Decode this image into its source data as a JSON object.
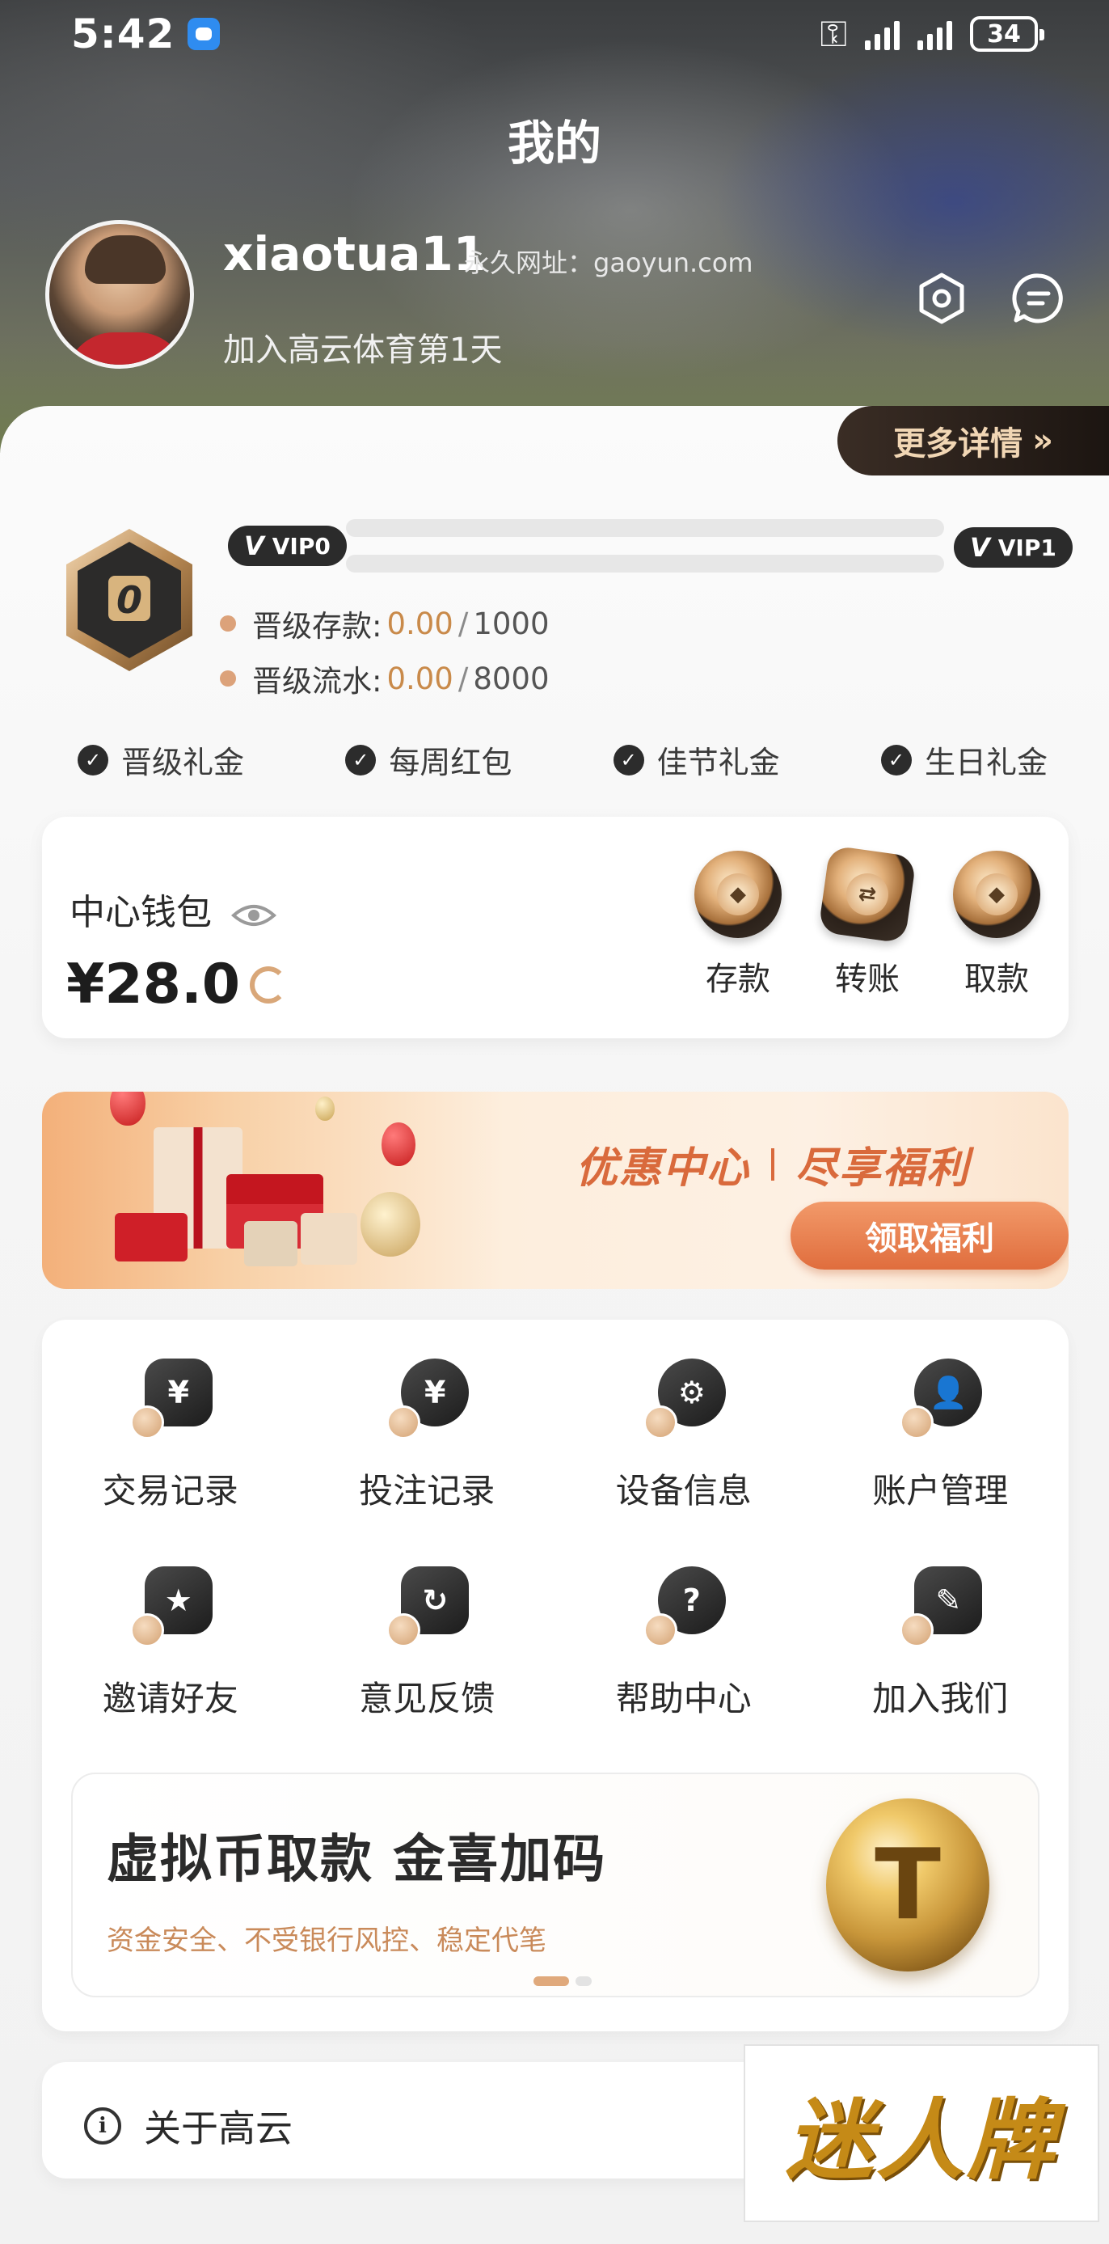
{
  "status_bar": {
    "time": "5:42",
    "battery": "34"
  },
  "header": {
    "title": "我的",
    "username": "xiaotua11",
    "perma_url": "永久网址：gaoyun.com",
    "join_days": "加入高云体育第1天"
  },
  "more_details": {
    "label": "更多详情",
    "arrow": "»"
  },
  "vip": {
    "badge_text": "0",
    "current_level": "VIP0",
    "next_level": "VIP1",
    "deposit_label": "晋级存款:",
    "deposit_current": "0.00",
    "deposit_target": "1000",
    "turnover_label": "晋级流水:",
    "turnover_current": "0.00",
    "turnover_target": "8000",
    "deposit_progress": 0,
    "turnover_progress": 0,
    "separator": "/"
  },
  "perks": [
    "晋级礼金",
    "每周红包",
    "佳节礼金",
    "生日礼金"
  ],
  "wallet": {
    "title": "中心钱包",
    "balance": "¥28.0",
    "actions": [
      {
        "label": "存款",
        "icon": "deposit-coin-icon"
      },
      {
        "label": "转账",
        "icon": "transfer-coin-icon"
      },
      {
        "label": "取款",
        "icon": "withdraw-coin-icon"
      }
    ]
  },
  "promo": {
    "title_left": "优惠中心",
    "title_right": "尽享福利",
    "button": "领取福利"
  },
  "functions": [
    {
      "label": "交易记录",
      "glyph": "¥"
    },
    {
      "label": "投注记录",
      "glyph": "¥"
    },
    {
      "label": "设备信息",
      "glyph": "⚙"
    },
    {
      "label": "账户管理",
      "glyph": "👤"
    },
    {
      "label": "邀请好友",
      "glyph": "★"
    },
    {
      "label": "意见反馈",
      "glyph": "↻"
    },
    {
      "label": "帮助中心",
      "glyph": "?"
    },
    {
      "label": "加入我们",
      "glyph": "✎"
    }
  ],
  "crypto_banner": {
    "title": "虚拟币取款  金喜加码",
    "subtitle": "资金安全、不受银行风控、稳定代笔",
    "coin_glyph": "T"
  },
  "about": {
    "label": "关于高云"
  },
  "watermark": {
    "text": "迷人牌"
  },
  "colors": {
    "accent": "#d9a779",
    "promo_orange": "#e06d3d",
    "dark": "#2b2b2b"
  }
}
